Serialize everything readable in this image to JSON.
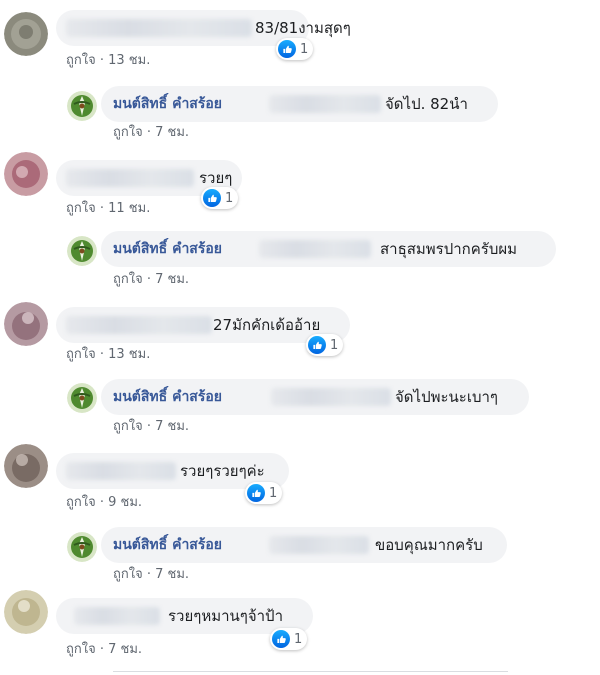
{
  "colors": {
    "author": "#385898",
    "meta": "#606770",
    "bubble": "#f2f3f5",
    "like": "#1877f2"
  },
  "comments": [
    {
      "text": "83/81งามสุดๆ",
      "like_label": "ถูกใจ",
      "time": "13 ชม.",
      "reaction_count": "1",
      "reaction_icon": "like-thumb-icon",
      "reply": {
        "author": "มนต์สิทธิ์ คำสร้อย",
        "text": "จัดไป. 82นำ",
        "like_label": "ถูกใจ",
        "time": "7 ชม."
      }
    },
    {
      "text": "รวยๆ",
      "like_label": "ถูกใจ",
      "time": "11 ชม.",
      "reaction_count": "1",
      "reaction_icon": "like-thumb-icon",
      "reply": {
        "author": "มนต์สิทธิ์ คำสร้อย",
        "text": "สาธุสมพรปากครับผม",
        "like_label": "ถูกใจ",
        "time": "7 ชม."
      }
    },
    {
      "text": "27มักคักเด้ออ้าย",
      "like_label": "ถูกใจ",
      "time": "13 ชม.",
      "reaction_count": "1",
      "reaction_icon": "like-thumb-icon",
      "reply": {
        "author": "มนต์สิทธิ์ คำสร้อย",
        "text": "จัดไปพะนะเบาๆ",
        "like_label": "ถูกใจ",
        "time": "7 ชม."
      }
    },
    {
      "text": "รวยๆรวยๆค่ะ",
      "like_label": "ถูกใจ",
      "time": "9 ชม.",
      "reaction_count": "1",
      "reaction_icon": "like-thumb-icon",
      "reply": {
        "author": "มนต์สิทธิ์ คำสร้อย",
        "text": "ขอบคุณมากครับ",
        "like_label": "ถูกใจ",
        "time": "7 ชม."
      }
    },
    {
      "text": "รวยๆหมานๆจ้าป้า",
      "like_label": "ถูกใจ",
      "time": "7 ชม.",
      "reaction_count": "1",
      "reaction_icon": "like-thumb-icon"
    }
  ]
}
